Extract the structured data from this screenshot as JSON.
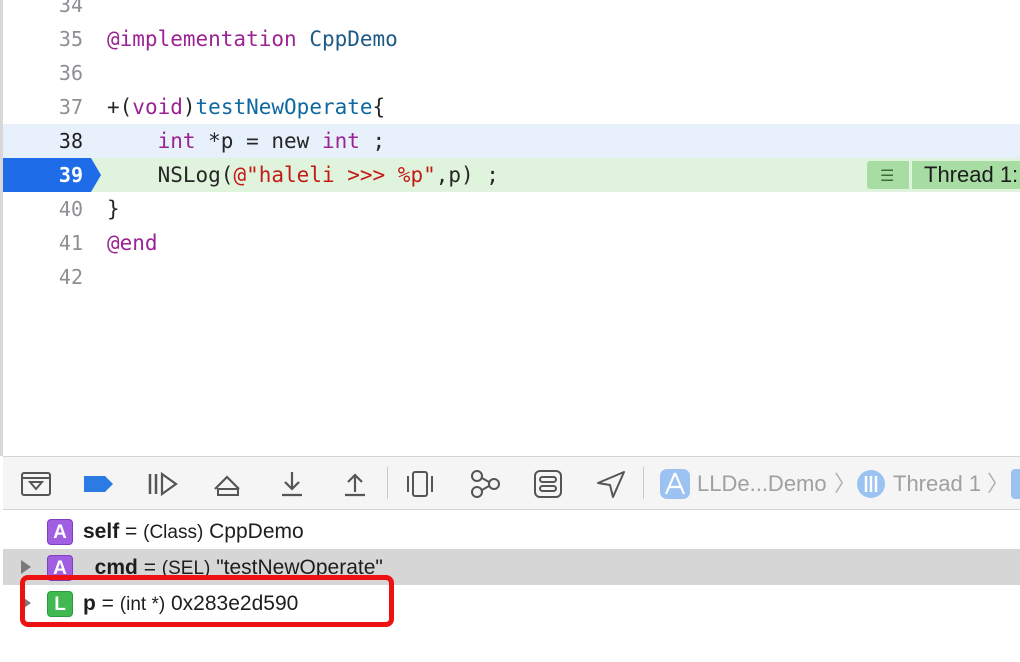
{
  "editor": {
    "lines": [
      {
        "num": "34",
        "segments": []
      },
      {
        "num": "35",
        "segments": [
          {
            "t": "@implementation",
            "c": "kw"
          },
          {
            "t": " ",
            "c": ""
          },
          {
            "t": "CppDemo",
            "c": "cls"
          }
        ]
      },
      {
        "num": "36",
        "segments": []
      },
      {
        "num": "37",
        "segments": [
          {
            "t": "+(",
            "c": ""
          },
          {
            "t": "void",
            "c": "kw"
          },
          {
            "t": ")",
            "c": ""
          },
          {
            "t": "testNewOperate",
            "c": "fn"
          },
          {
            "t": "{",
            "c": ""
          }
        ]
      },
      {
        "num": "38",
        "segments": [
          {
            "t": "    ",
            "c": ""
          },
          {
            "t": "int",
            "c": "kw"
          },
          {
            "t": " *p = new ",
            "c": ""
          },
          {
            "t": "int",
            "c": "kw"
          },
          {
            "t": " ;",
            "c": ""
          }
        ]
      },
      {
        "num": "39",
        "segments": [
          {
            "t": "    NSLog(",
            "c": ""
          },
          {
            "t": "@\"haleli >>> %p\"",
            "c": "str"
          },
          {
            "t": ",p) ;",
            "c": ""
          }
        ]
      },
      {
        "num": "40",
        "segments": [
          {
            "t": "}",
            "c": ""
          }
        ]
      },
      {
        "num": "41",
        "segments": [
          {
            "t": "@end",
            "c": "kw"
          }
        ]
      },
      {
        "num": "42",
        "segments": []
      }
    ],
    "current_line": "38",
    "pc_line": "39",
    "thread_label": "Thread 1:"
  },
  "toolbar": {
    "buttons": [
      {
        "name": "hide-debug-area-button",
        "icon": "panel-toggle-icon"
      },
      {
        "name": "breakpoints-toggle-button",
        "icon": "breakpoint-icon"
      },
      {
        "name": "continue-button",
        "icon": "continue-icon"
      },
      {
        "name": "step-over-button",
        "icon": "step-over-icon"
      },
      {
        "name": "step-into-button",
        "icon": "step-into-icon"
      },
      {
        "name": "step-out-button",
        "icon": "step-out-icon"
      },
      {
        "name": "debug-view-hierarchy-button",
        "icon": "view-hierarchy-icon"
      },
      {
        "name": "debug-memory-graph-button",
        "icon": "memory-graph-icon"
      },
      {
        "name": "environment-overrides-button",
        "icon": "environment-icon"
      },
      {
        "name": "simulate-location-button",
        "icon": "location-icon"
      }
    ],
    "breadcrumb": {
      "app": "LLDe...Demo",
      "thread": "Thread 1"
    },
    "accent_color": "#2b7be4"
  },
  "variables": {
    "rows": [
      {
        "badge": "A",
        "name": "self",
        "eq": " = ",
        "type": "(Class)",
        "value": " CppDemo",
        "expandable": false,
        "selected": false
      },
      {
        "badge": "A",
        "name": "_cmd",
        "eq": " = ",
        "type": "(SEL)",
        "value": " \"testNewOperate\"",
        "expandable": true,
        "selected": true
      },
      {
        "badge": "L",
        "name": "p",
        "eq": " = ",
        "type": "(int *)",
        "value": " 0x283e2d590",
        "expandable": true,
        "selected": false
      }
    ]
  }
}
